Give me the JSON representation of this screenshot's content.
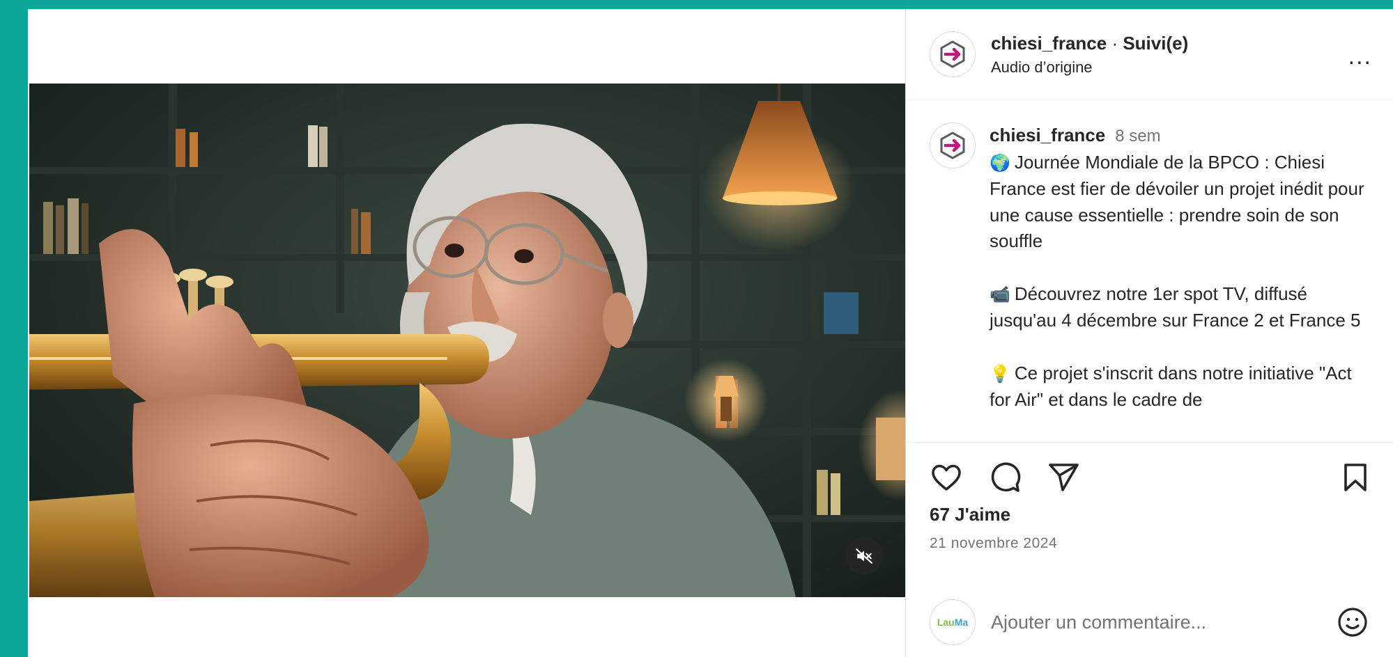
{
  "account": {
    "username": "chiesi_france",
    "separator": " · ",
    "follow_status": "Suivi(e)",
    "audio": "Audio d’origine",
    "more_label": "..."
  },
  "caption": {
    "username": "chiesi_france",
    "time_ago": "8 sem",
    "paragraphs": [
      {
        "emoji": "🌍",
        "text": "Journée Mondiale de la BPCO : Chiesi France est fier de dévoiler un projet inédit pour une cause essentielle : prendre soin de son souffle"
      },
      {
        "emoji": "📹",
        "text": "Découvrez notre 1er spot TV, diffusé jusqu'au 4 décembre sur France 2 et France 5"
      },
      {
        "emoji": "💡",
        "text": "Ce projet s'inscrit dans notre initiative \"Act for Air\" et dans le cadre de"
      }
    ]
  },
  "stats": {
    "likes": "67 J'aime",
    "date": "21 novembre 2024"
  },
  "comment": {
    "placeholder": "Ajouter un commentaire...",
    "avatar_text_a": "Lau",
    "avatar_text_b": "Ma"
  },
  "icons": {
    "like": "heart-icon",
    "comment": "comment-bubble-icon",
    "share": "paper-plane-icon",
    "save": "bookmark-icon",
    "mute": "speaker-muted-icon",
    "emoji": "smiley-icon"
  },
  "colors": {
    "page_background": "#0ba899",
    "brand_magenta": "#c4157f",
    "muted_text": "#737373"
  }
}
